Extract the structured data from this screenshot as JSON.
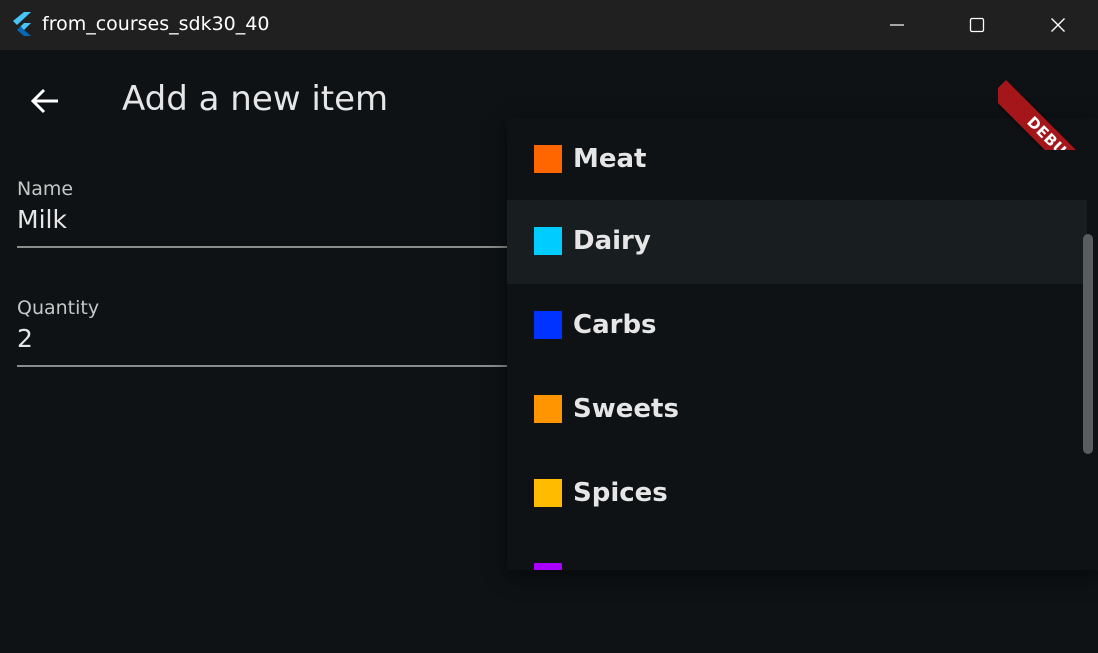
{
  "window": {
    "title": "from_courses_sdk30_40",
    "controls": {
      "minimize": "minimize-icon",
      "maximize": "maximize-icon",
      "close": "close-icon"
    }
  },
  "appbar": {
    "back_icon": "arrow-left-icon",
    "title": "Add a new item"
  },
  "form": {
    "name": {
      "label": "Name",
      "value": "Milk"
    },
    "quantity": {
      "label": "Quantity",
      "value": "2"
    }
  },
  "dropdown": {
    "selected": "Dairy",
    "items": [
      {
        "label": "Meat",
        "color": "#ff6600"
      },
      {
        "label": "Dairy",
        "color": "#00ccff"
      },
      {
        "label": "Carbs",
        "color": "#0033ff"
      },
      {
        "label": "Sweets",
        "color": "#ff9500"
      },
      {
        "label": "Spices",
        "color": "#ffbb00"
      },
      {
        "label": "",
        "color": "#aa00ff"
      }
    ]
  },
  "debug_banner": {
    "label": "DEBUG"
  },
  "colors": {
    "background": "#0e1215",
    "titlebar": "#202020",
    "debug": "#a4161a"
  }
}
